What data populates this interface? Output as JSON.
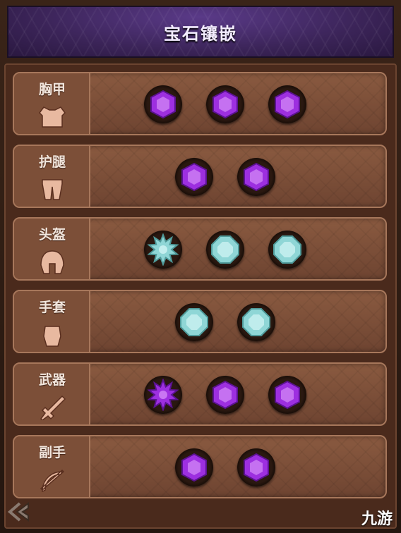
{
  "header": {
    "title": "宝石镶嵌"
  },
  "colors": {
    "purple": "#9d2fe0",
    "teal": "#8fd6d6"
  },
  "slots": [
    {
      "name": "胸甲",
      "icon": "chest-armor-icon",
      "gems": [
        "purple-hex",
        "purple-hex",
        "purple-hex"
      ]
    },
    {
      "name": "护腿",
      "icon": "leg-armor-icon",
      "gems": [
        "purple-hex",
        "purple-hex"
      ]
    },
    {
      "name": "头盔",
      "icon": "helmet-icon",
      "gems": [
        "teal-star",
        "teal-octagon",
        "teal-octagon"
      ]
    },
    {
      "name": "手套",
      "icon": "glove-icon",
      "gems": [
        "teal-octagon",
        "teal-octagon"
      ]
    },
    {
      "name": "武器",
      "icon": "weapon-icon",
      "gems": [
        "purple-star",
        "purple-hex",
        "purple-hex"
      ]
    },
    {
      "name": "副手",
      "icon": "offhand-bow-icon",
      "gems": [
        "purple-hex",
        "purple-hex"
      ]
    }
  ],
  "footer": {
    "back_icon": "back-arrow-icon",
    "logo_text": "九游"
  }
}
